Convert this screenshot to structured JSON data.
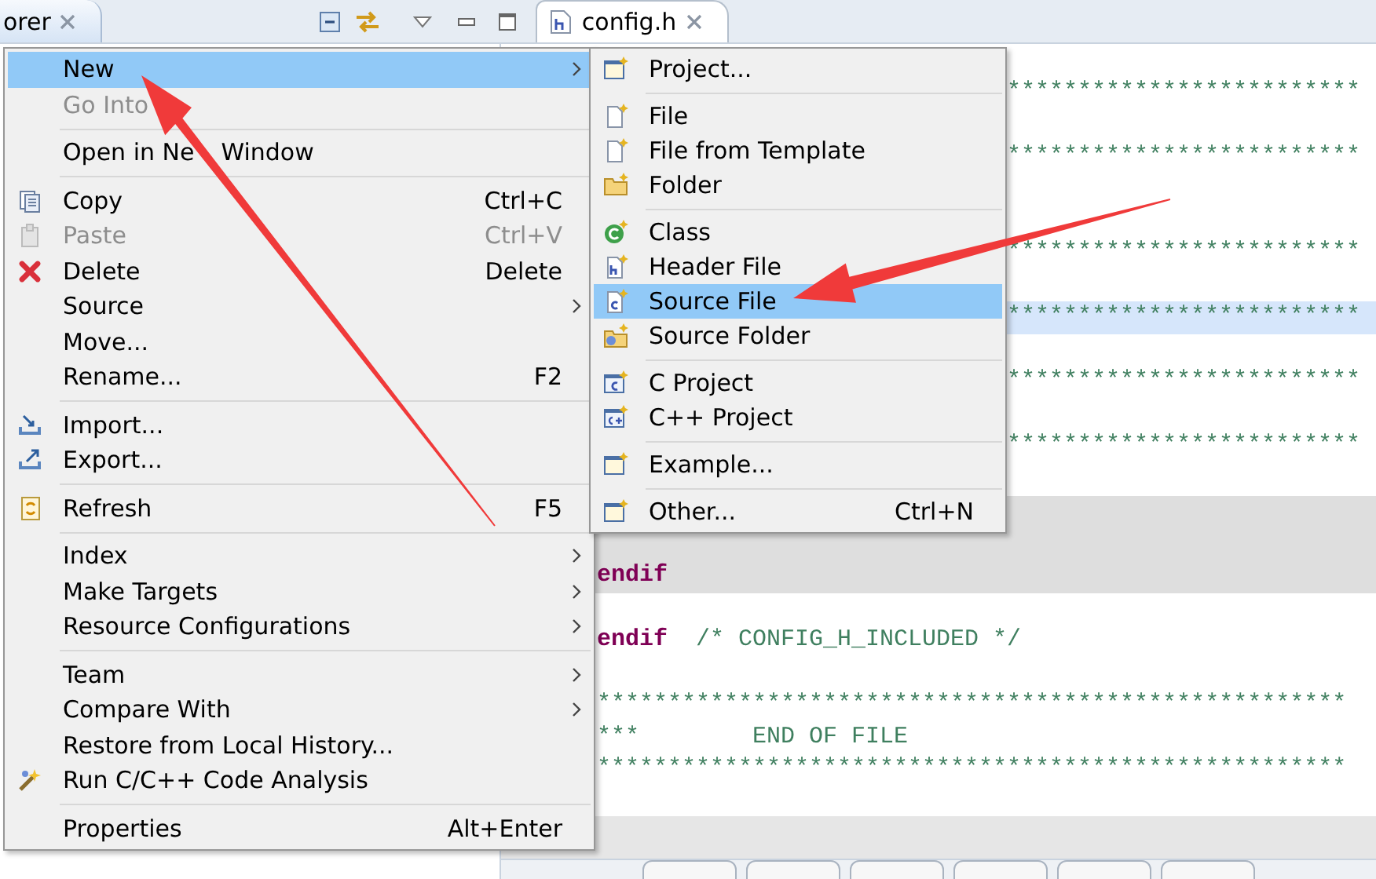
{
  "view_tab": {
    "label": "orer"
  },
  "editor_tab": {
    "label": "config.h"
  },
  "menu": {
    "items": [
      {
        "kind": "item",
        "label": "New",
        "submenu": true,
        "selected": true,
        "disabled": false
      },
      {
        "kind": "item",
        "label": "Go Into",
        "selected": false,
        "disabled": true
      },
      {
        "kind": "separator"
      },
      {
        "kind": "item",
        "label": "Open in Ne",
        "label_rest": "Window",
        "selected": false,
        "disabled": false
      },
      {
        "kind": "separator"
      },
      {
        "kind": "item",
        "label": "Copy",
        "shortcut": "Ctrl+C",
        "selected": false,
        "disabled": false
      },
      {
        "kind": "item",
        "label": "Paste",
        "shortcut": "Ctrl+V",
        "selected": false,
        "disabled": true
      },
      {
        "kind": "item",
        "label": "Delete",
        "shortcut": "Delete",
        "selected": false,
        "disabled": false
      },
      {
        "kind": "item",
        "label": "Source",
        "submenu": true,
        "selected": false,
        "disabled": false
      },
      {
        "kind": "item",
        "label": "Move...",
        "selected": false,
        "disabled": false
      },
      {
        "kind": "item",
        "label": "Rename...",
        "shortcut": "F2",
        "selected": false,
        "disabled": false
      },
      {
        "kind": "separator"
      },
      {
        "kind": "item",
        "label": "Import...",
        "selected": false,
        "disabled": false
      },
      {
        "kind": "item",
        "label": "Export...",
        "selected": false,
        "disabled": false
      },
      {
        "kind": "separator"
      },
      {
        "kind": "item",
        "label": "Refresh",
        "shortcut": "F5",
        "selected": false,
        "disabled": false
      },
      {
        "kind": "separator"
      },
      {
        "kind": "item",
        "label": "Index",
        "submenu": true,
        "selected": false,
        "disabled": false
      },
      {
        "kind": "item",
        "label": "Make Targets",
        "submenu": true,
        "selected": false,
        "disabled": false
      },
      {
        "kind": "item",
        "label": "Resource Configurations",
        "submenu": true,
        "selected": false,
        "disabled": false
      },
      {
        "kind": "separator"
      },
      {
        "kind": "item",
        "label": "Team",
        "submenu": true,
        "selected": false,
        "disabled": false
      },
      {
        "kind": "item",
        "label": "Compare With",
        "submenu": true,
        "selected": false,
        "disabled": false
      },
      {
        "kind": "item",
        "label": "Restore from Local History...",
        "selected": false,
        "disabled": false
      },
      {
        "kind": "item",
        "label": "Run C/C++ Code Analysis",
        "selected": false,
        "disabled": false
      },
      {
        "kind": "separator"
      },
      {
        "kind": "item",
        "label": "Properties",
        "shortcut": "Alt+Enter",
        "selected": false,
        "disabled": false
      }
    ]
  },
  "submenu": {
    "items": [
      {
        "kind": "item",
        "label": "Project...",
        "selected": false,
        "disabled": false
      },
      {
        "kind": "separator"
      },
      {
        "kind": "item",
        "label": "File",
        "selected": false,
        "disabled": false
      },
      {
        "kind": "item",
        "label": "File from Template",
        "selected": false,
        "disabled": false
      },
      {
        "kind": "item",
        "label": "Folder",
        "selected": false,
        "disabled": false
      },
      {
        "kind": "separator"
      },
      {
        "kind": "item",
        "label": "Class",
        "selected": false,
        "disabled": false
      },
      {
        "kind": "item",
        "label": "Header File",
        "selected": false,
        "disabled": false
      },
      {
        "kind": "item",
        "label": "Source File",
        "selected": true,
        "disabled": false
      },
      {
        "kind": "item",
        "label": "Source Folder",
        "selected": false,
        "disabled": false
      },
      {
        "kind": "separator"
      },
      {
        "kind": "item",
        "label": "C Project",
        "selected": false,
        "disabled": false
      },
      {
        "kind": "item",
        "label": "C++ Project",
        "selected": false,
        "disabled": false
      },
      {
        "kind": "separator"
      },
      {
        "kind": "item",
        "label": "Example...",
        "selected": false,
        "disabled": false
      },
      {
        "kind": "separator"
      },
      {
        "kind": "item",
        "label": "Other...",
        "shortcut": "Ctrl+N",
        "selected": false,
        "disabled": false
      }
    ]
  },
  "editor": {
    "upper_lines": [
      {
        "kind": "blank",
        "current": false
      },
      {
        "kind": "code",
        "current": false,
        "segments": [
          {
            "kind": "comment",
            "text": "*************************"
          }
        ]
      },
      {
        "kind": "blank",
        "current": false
      },
      {
        "kind": "code",
        "current": false,
        "segments": [
          {
            "kind": "comment",
            "text": "*************************"
          }
        ]
      },
      {
        "kind": "blank",
        "current": false
      },
      {
        "kind": "blank",
        "current": false
      },
      {
        "kind": "code",
        "current": false,
        "segments": [
          {
            "kind": "comment",
            "text": "*************************"
          }
        ]
      },
      {
        "kind": "blank",
        "current": false
      },
      {
        "kind": "code",
        "current": true,
        "segments": [
          {
            "kind": "comment",
            "text": "*************************"
          }
        ]
      },
      {
        "kind": "blank",
        "current": false
      },
      {
        "kind": "code",
        "current": false,
        "segments": [
          {
            "kind": "comment",
            "text": "*************************"
          }
        ]
      },
      {
        "kind": "blank",
        "current": false
      },
      {
        "kind": "code",
        "current": false,
        "segments": [
          {
            "kind": "comment",
            "text": "*************************"
          }
        ]
      },
      {
        "kind": "blank",
        "current": false
      }
    ],
    "shaded_lines": [
      {
        "kind": "blank"
      },
      {
        "kind": "blank"
      },
      {
        "kind": "code",
        "segments": [
          {
            "kind": "keyword",
            "text": "endif"
          }
        ]
      }
    ],
    "lower_lines": [
      {
        "kind": "blank"
      },
      {
        "kind": "code",
        "segments": [
          {
            "kind": "keyword",
            "text": "endif"
          },
          {
            "kind": "comment",
            "text": "/* CONFIG_H_INCLUDED */"
          }
        ]
      },
      {
        "kind": "blank"
      },
      {
        "kind": "code",
        "segments": [
          {
            "kind": "comment",
            "text": "*****************************************************"
          }
        ]
      },
      {
        "kind": "code",
        "segments": [
          {
            "kind": "comment",
            "text": "***        END OF FILE"
          }
        ]
      },
      {
        "kind": "code",
        "segments": [
          {
            "kind": "comment",
            "text": "*****************************************************"
          }
        ]
      }
    ]
  }
}
